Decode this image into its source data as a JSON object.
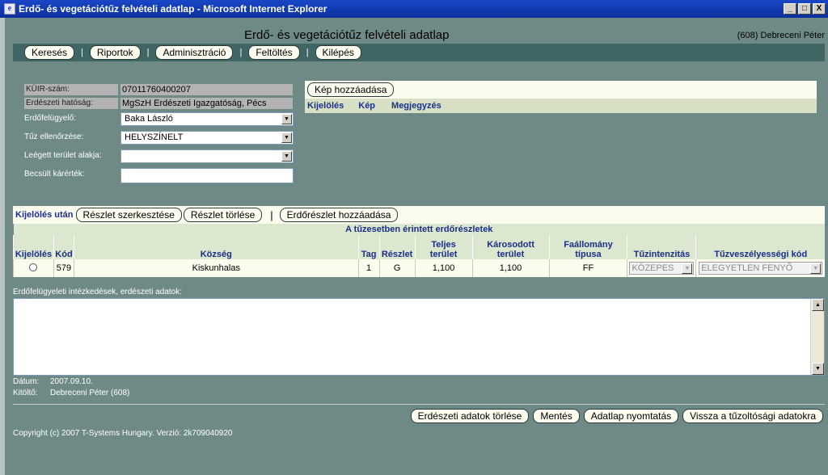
{
  "window": {
    "title": "Erdő- és vegetációtűz felvételi adatlap - Microsoft Internet Explorer",
    "minimize": "_",
    "maximize": "□",
    "close": "X"
  },
  "header": {
    "page_title": "Erdő- és vegetációtűz felvételi adatlap",
    "user": "(608) Debreceni Péter"
  },
  "menu": {
    "items": [
      "Keresés",
      "Riportok",
      "Adminisztráció",
      "Feltöltés",
      "Kilépés"
    ],
    "separator": "|"
  },
  "form": {
    "kuir_label": "KÜIR-szám:",
    "kuir_value": "07011760400207",
    "authority_label": "Erdészeti hatóság:",
    "authority_value": "MgSzH Erdészeti Igazgatóság, Pécs",
    "inspector_label": "Erdőfelügyelő:",
    "inspector_value": "Baka László",
    "fire_check_label": "Tűz ellenőrzése:",
    "fire_check_value": "HELYSZÍNELT",
    "area_shape_label": "Leégett terület alakja:",
    "area_shape_value": "",
    "damage_label": "Becsült kárérték:",
    "damage_value": ""
  },
  "images": {
    "add_button": "Kép hozzáadása",
    "columns": [
      "Kijelölés",
      "Kép",
      "Megjegyzés"
    ]
  },
  "section": {
    "selection_label": "Kijelölés után",
    "edit_button": "Részlet szerkesztése",
    "delete_button": "Részlet törlése",
    "separator": "|",
    "add_button": "Erdőrészlet hozzáadása"
  },
  "table": {
    "caption": "A tűzesetben érintett erdőrészletek",
    "headers": {
      "select": "Kijelölés",
      "code": "Kód",
      "municipality": "Község",
      "tag": "Tag",
      "part": "Részlet",
      "total_area_1": "Teljes",
      "total_area_2": "terület",
      "damaged_area_1": "Károsodott",
      "damaged_area_2": "terület",
      "stand_type_1": "Faállomány",
      "stand_type_2": "típusa",
      "intensity": "Tűzintenzitás",
      "hazard": "Tűzveszélyességi kód"
    },
    "rows": [
      {
        "code": "579",
        "municipality": "Kiskunhalas",
        "tag": "1",
        "part": "G",
        "total_area": "1,100",
        "damaged_area": "1,100",
        "stand_type": "FF",
        "intensity": "KÖZEPES",
        "hazard": "ELEGYETLEN FENYŐ"
      }
    ]
  },
  "notes": {
    "label": "Erdőfelügyeleti intézkedések, erdészeti adatok:",
    "value": ""
  },
  "meta": {
    "date_label": "Dátum:",
    "date_value": "2007.09.10.",
    "filler_label": "Kitöltő:",
    "filler_value": "Debreceni Péter (608)"
  },
  "actions": {
    "delete_forestry": "Erdészeti adatok törlése",
    "save": "Mentés",
    "print": "Adatlap nyomtatás",
    "back": "Vissza a tűzoltósági adatokra"
  },
  "footer": {
    "copyright": "Copyright (c) 2007 T-Systems Hungary. Verzió: 2k709040920"
  }
}
